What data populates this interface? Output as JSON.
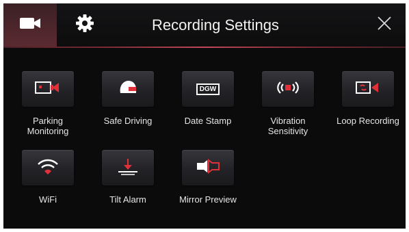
{
  "header": {
    "title": "Recording Settings",
    "tabs": [
      {
        "icon": "video-camera-icon",
        "selected": true
      },
      {
        "icon": "gear-icon",
        "selected": false
      }
    ],
    "close_icon": "close-icon"
  },
  "colors": {
    "accent": "#e0303a",
    "background": "#0b0b0c",
    "text": "#e6e6e6",
    "selected_tab": "#4a252b"
  },
  "items": [
    {
      "label_lines": [
        "Parking",
        "Monitoring"
      ],
      "icon": "parking-camera-icon"
    },
    {
      "label_lines": [
        "Safe Driving"
      ],
      "icon": "helmet-icon"
    },
    {
      "label_lines": [
        "Date Stamp"
      ],
      "icon": "date-stamp-icon",
      "icon_text": "DGW"
    },
    {
      "label_lines": [
        "Vibration",
        "Sensitivity"
      ],
      "icon": "vibration-icon"
    },
    {
      "label_lines": [
        "Loop Recording"
      ],
      "icon": "loop-recording-icon"
    },
    {
      "label_lines": [
        "WiFi"
      ],
      "icon": "wifi-icon"
    },
    {
      "label_lines": [
        "Tilt Alarm"
      ],
      "icon": "tilt-alarm-icon"
    },
    {
      "label_lines": [
        "Mirror Preview"
      ],
      "icon": "mirror-preview-icon"
    }
  ]
}
